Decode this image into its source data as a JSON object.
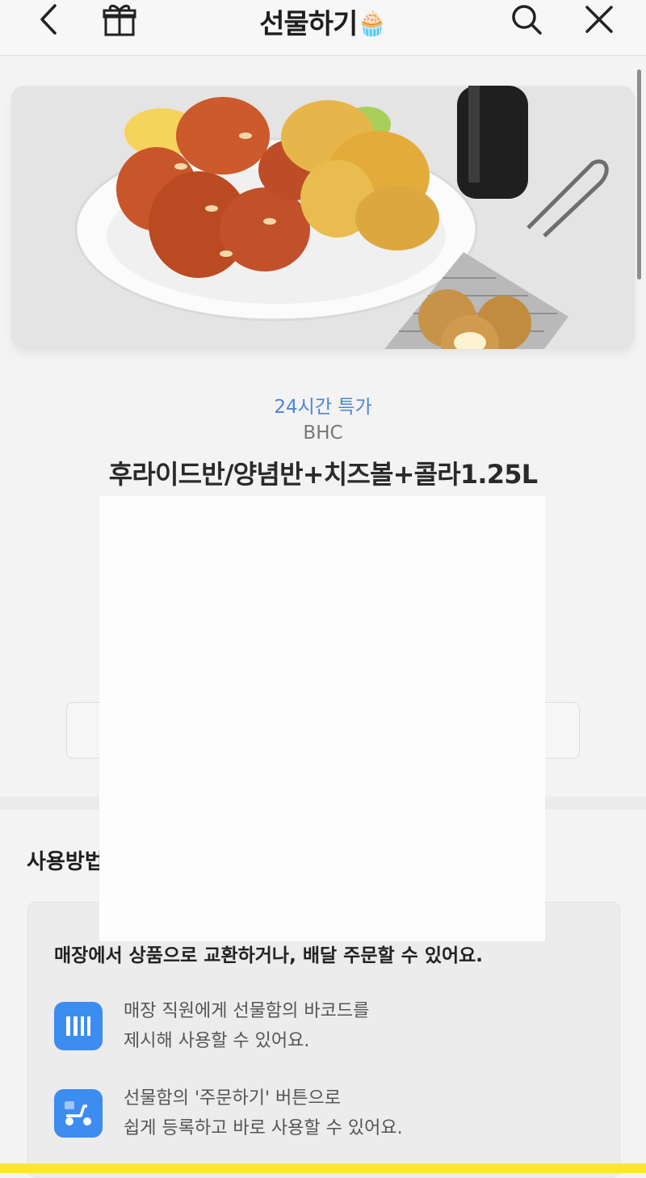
{
  "header": {
    "title": "선물하기",
    "title_emoji": "🧁",
    "icons": [
      "back-arrow-icon",
      "gift-box-icon",
      "search-icon",
      "close-icon"
    ]
  },
  "product": {
    "badge": "24시간 특가",
    "brand": "BHC",
    "name": "후라이드반/양념반+치즈볼+콜라1.25L"
  },
  "usage": {
    "title": "사용방법",
    "headline": "매장에서 상품으로 교환하거나, 배달 주문할 수 있어요.",
    "items": [
      {
        "line1": "매장 직원에게 선물함의 바코드를",
        "line2": "제시해 사용할 수 있어요.",
        "icon": "barcode-icon"
      },
      {
        "line1": "선물함의 '주문하기' 버튼으로",
        "line2": "쉽게 등록하고 바로 사용할 수 있어요.",
        "icon": "delivery-scooter-icon"
      }
    ]
  },
  "colors": {
    "accent": "#4b86d6",
    "icon_bg": "#3d8cf0",
    "bottom_bar": "#fde633"
  }
}
